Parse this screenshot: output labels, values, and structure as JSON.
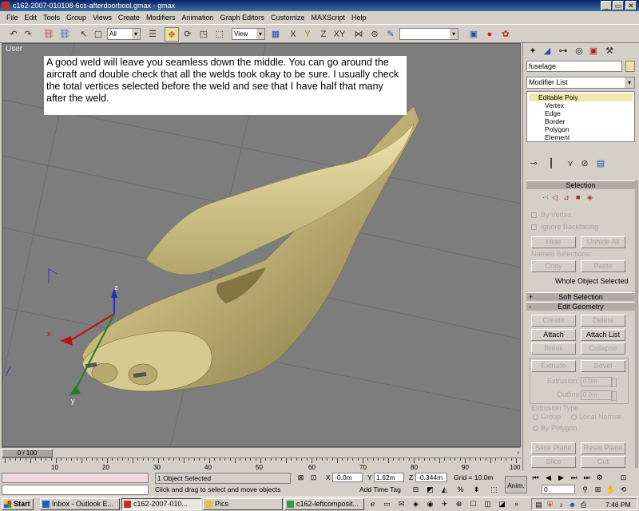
{
  "window": {
    "title": "c162-2007-010108-6cs-afterdoorbool.gmax - gmax",
    "minimize": "_",
    "maximize": "▭",
    "close": "✕"
  },
  "menu": [
    "File",
    "Edit",
    "Tools",
    "Group",
    "Views",
    "Create",
    "Modifiers",
    "Animation",
    "Graph Editors",
    "Customize",
    "MAXScript",
    "Help"
  ],
  "toolbar": {
    "filter_value": "All",
    "coord_value": "View",
    "named_sel_value": ""
  },
  "viewport": {
    "label": "User",
    "annotation": "A good weld will leave you seamless down the middle.  You can go around the aircraft and double check that all the welds took okay to be sure.  I usually check the total vertices selected before the weld and see that I have half that many after the weld.",
    "axis_z": "z",
    "axis_x": "x",
    "axis_y": "y",
    "model_color": "#c4b67a"
  },
  "panel": {
    "object_name": "fuselage",
    "modifier_list": "Modifier List",
    "stack": {
      "base": "Editable Poly",
      "subs": [
        "Vertex",
        "Edge",
        "Border",
        "Polygon",
        "Element"
      ]
    },
    "selection": {
      "title": "Selection",
      "by_vertex": "By Vertex",
      "ignore_backfacing": "Ignore Backfacing",
      "hide": "Hide",
      "unhide_all": "Unhide All",
      "named_selections": "Named Selections:",
      "copy": "Copy",
      "paste": "Paste",
      "status": "Whole Object Selected"
    },
    "soft_selection": {
      "title": "Soft Selection",
      "sign": "+"
    },
    "edit_geometry": {
      "title": "Edit Geometry",
      "sign": "-",
      "create": "Create",
      "delete": "Delete",
      "attach": "Attach",
      "attach_list": "Attach List",
      "break": "Break",
      "collapse": "Collapse",
      "extrude": "Extrude",
      "bevel": "Bevel",
      "extrusion_label": "Extrusion:",
      "extrusion_value": "0.0m",
      "outline_label": "Outline:",
      "outline_value": "0.0m",
      "extrusion_type": "Extrusion Type",
      "group": "Group",
      "local_normal": "Local Normal",
      "by_polygon": "By Polygon",
      "slice_plane": "Slice Plane",
      "reset_plane": "Reset Plane",
      "slice": "Slice",
      "cut": "Cut"
    }
  },
  "timeline": {
    "slider_text": "0 / 100",
    "ticks": [
      "10",
      "20",
      "30",
      "40",
      "50",
      "60",
      "70",
      "80",
      "90",
      "100"
    ],
    "frame_fraction": 0.0
  },
  "status": {
    "selected": "1 Object Selected",
    "prompt": "Click and drag to select and move objects",
    "x_label": "X",
    "x_value": "-0.0m",
    "y_label": "Y",
    "y_value": "1.62m",
    "z_label": "Z",
    "z_value": "-0.344m",
    "grid": "Grid = 10.0m",
    "add_time_tag": "Add Time Tag",
    "anim": "Anim.",
    "frame_value": "0"
  },
  "taskbar": {
    "start": "Start",
    "items": [
      "Inbox - Outlook E...",
      "c162-2007-010...",
      "Pics",
      "c162-leftcomposit..."
    ],
    "clock": "7:46 PM"
  }
}
